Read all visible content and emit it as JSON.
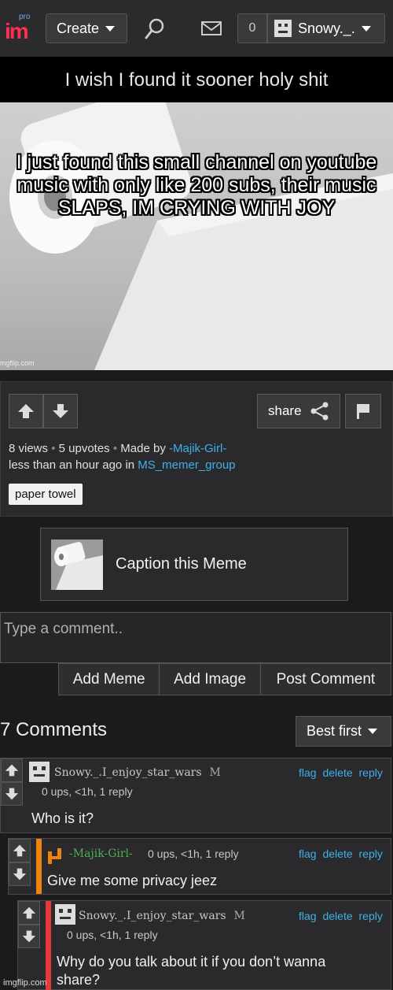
{
  "nav": {
    "logo_pro": "pro",
    "logo_text": "im",
    "create_label": "Create",
    "notification_count": "0",
    "username": "Snowy._."
  },
  "meme": {
    "title": "I wish I found it sooner holy shit",
    "caption": "I just found this small channel on youtube music with only like 200 subs, their music SLAPS, IM CRYING WITH JOY",
    "watermark": "mgflip.com"
  },
  "info": {
    "share_label": "share",
    "views": "8 views",
    "upvotes": "5 upvotes",
    "made_by_label": "Made by",
    "author": "-Majik-Girl-",
    "time_text": "less than an hour ago in",
    "stream": "MS_memer_group",
    "tag": "paper towel"
  },
  "caption_box": {
    "label": "Caption this Meme"
  },
  "comment_input": {
    "placeholder": "Type a comment.."
  },
  "comment_actions": [
    "Add Meme",
    "Add Image",
    "Post Comment"
  ],
  "comments_header": {
    "count": "7 Comments",
    "sort_label": "Best first"
  },
  "comments": [
    {
      "user": "Snowy._.I_enjoy_star_wars",
      "mark": "M",
      "meta": "0 ups, <1h, 1 reply",
      "text": "Who is it?",
      "actions": [
        "flag",
        "delete",
        "reply"
      ]
    },
    {
      "user": "-Majik-Girl-",
      "meta": "0 ups, <1h, 1 reply",
      "text": "Give me some privacy jeez",
      "actions": [
        "flag",
        "delete",
        "reply"
      ],
      "accent": "#f0830e"
    },
    {
      "user": "Snowy._.I_enjoy_star_wars",
      "mark": "M",
      "meta": "0 ups, <1h, 1 reply",
      "text": "Why do you talk about it if you don’t wanna share?",
      "actions": [
        "flag",
        "delete",
        "reply"
      ],
      "accent": "#e8393a"
    }
  ],
  "footer_watermark": "imgflip.com",
  "colors": {
    "link": "#3fb0e8",
    "brand": "#ff2f4d",
    "green_user": "#4caf50"
  }
}
